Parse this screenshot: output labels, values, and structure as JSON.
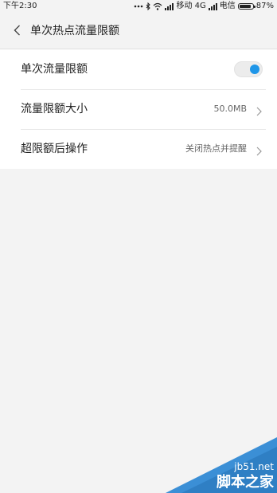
{
  "status_bar": {
    "time": "下午2:30",
    "carrier1": "移动 4G",
    "carrier2": "电信",
    "battery_text": "87%",
    "battery_level": 0.87,
    "icons": [
      "dots-icon",
      "bluetooth-icon",
      "wifi-icon",
      "signal-icon",
      "signal-icon",
      "battery-icon"
    ]
  },
  "header": {
    "title": "单次热点流量限额",
    "back_icon": "chevron-left-icon"
  },
  "settings": {
    "rows": [
      {
        "label": "单次流量限额",
        "type": "toggle",
        "on": true
      },
      {
        "label": "流量限额大小",
        "type": "value",
        "value": "50.0MB"
      },
      {
        "label": "超限额后操作",
        "type": "value",
        "value": "关闭热点并提醒"
      }
    ]
  },
  "watermark": {
    "site": "jb51.net",
    "text": "脚本之家"
  },
  "colors": {
    "accent": "#1f96e8",
    "background": "#f3f3f3",
    "card": "#ffffff",
    "watermark_bg": "#3b8fd6"
  }
}
